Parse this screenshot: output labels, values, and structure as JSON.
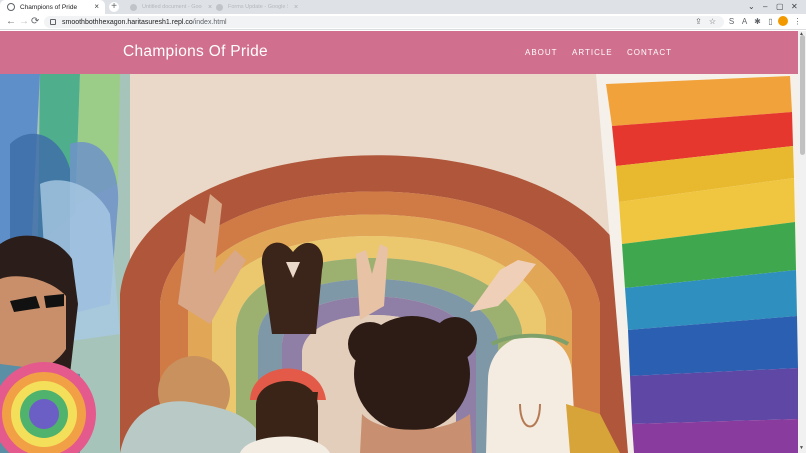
{
  "browser": {
    "active_tab": {
      "title": "Champions of Pride",
      "close": "×"
    },
    "new_tab": "+",
    "ghost_tabs": [
      {
        "title": "Untitled document - Google Docs",
        "close": "×"
      },
      {
        "title": "Forms Update - Google Search",
        "close": "×"
      }
    ],
    "window_controls": {
      "minimize": "–",
      "maximize": "▢",
      "close": "✕",
      "menu": "⌄"
    },
    "nav": {
      "back": "←",
      "forward": "→",
      "reload": "⟳"
    },
    "url": {
      "host": "smoothbothhexagon.haritasuresh1.repl.co",
      "path": "/index.html"
    },
    "toolbar_icons": {
      "share": "⇪",
      "bookmark": "☆",
      "ext1": "S",
      "read_aloud": "A",
      "extensions": "✱",
      "sidebar": "▯",
      "menu": "⋮"
    }
  },
  "site": {
    "brand": "Champions Of Pride",
    "nav": [
      "ABOUT",
      "ARTICLE",
      "CONTACT"
    ],
    "header_color": "#d16f8e"
  },
  "hero": {
    "description_icon": "pride-rainbow-illustration"
  },
  "scrollbar": {
    "up": "▲",
    "down": "▼"
  }
}
